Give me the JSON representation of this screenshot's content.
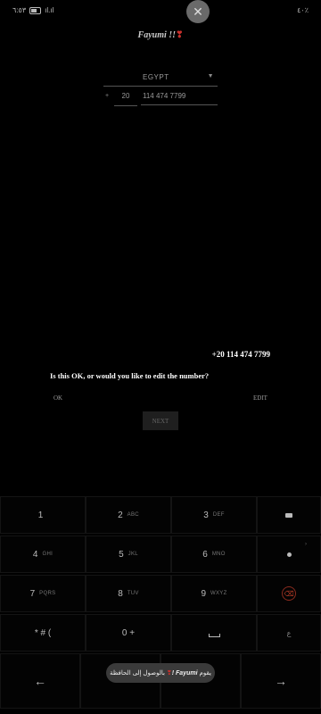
{
  "status_bar": {
    "left_text": "٦:٥٣",
    "right_text": "٤٠٪",
    "signal_text": "ıl.ıl"
  },
  "overlay": {
    "close_glyph": "✕"
  },
  "app": {
    "title": "Fayumi !!",
    "title_heart": "❣"
  },
  "form": {
    "country": "EGYPT",
    "country_arrow": "▼",
    "plus": "+",
    "country_code": "20",
    "phone_number": "114 474 7799"
  },
  "confirm": {
    "number": "+20 114 474 7799",
    "question": "Is this OK, or would you like to edit the number?",
    "ok_label": "OK",
    "edit_label": "EDIT",
    "next_label": "NEXT"
  },
  "keypad": {
    "keys": [
      {
        "digit": "1",
        "letters": ""
      },
      {
        "digit": "2",
        "letters": "ABC"
      },
      {
        "digit": "3",
        "letters": "DEF"
      },
      {
        "digit": "4",
        "letters": "GHI"
      },
      {
        "digit": "5",
        "letters": "JKL"
      },
      {
        "digit": "6",
        "letters": "MNO"
      },
      {
        "digit": "7",
        "letters": "PQRS"
      },
      {
        "digit": "8",
        "letters": "TUV"
      },
      {
        "digit": "9",
        "letters": "WXYZ"
      },
      {
        "digit": "* # (",
        "letters": ""
      },
      {
        "digit": "0 +",
        "letters": ""
      }
    ],
    "arabic_key": "ع",
    "left_arrow": "←",
    "right_arrow": "→",
    "edge_mark": "›"
  },
  "toast": {
    "text": "بالوصول إلى الحافظة",
    "app_name": "Fayumi !",
    "prefix": "يقوم"
  },
  "colors": {
    "background": "#000000",
    "accent_heart": "#c9302c",
    "delete_ring": "#8b2b1e"
  }
}
